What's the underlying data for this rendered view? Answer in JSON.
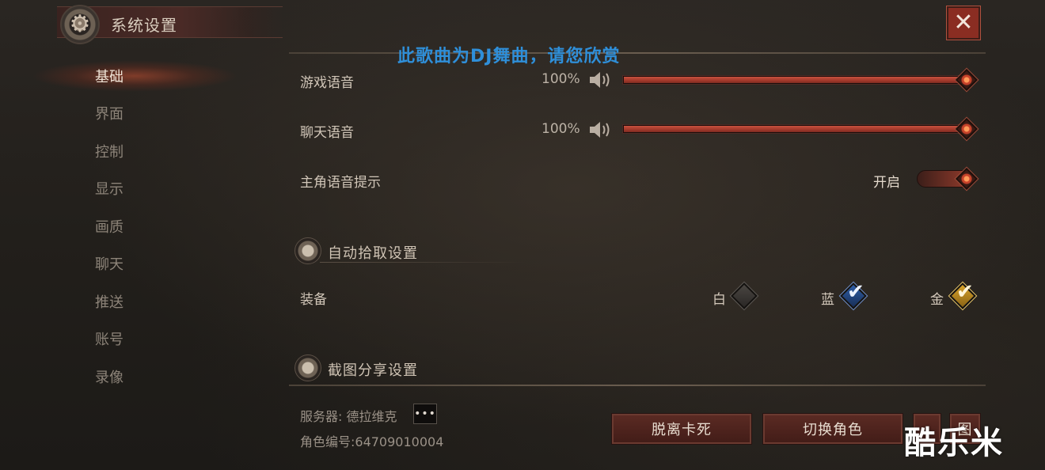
{
  "window": {
    "title": "系统设置",
    "close_glyph": "✕",
    "gear_glyph": "⚙"
  },
  "watermark_top": "此歌曲为DJ舞曲，请您欣赏",
  "watermark_bottom_right": "酷乐米",
  "sidebar": {
    "active_index": 0,
    "items": [
      {
        "label": "基础"
      },
      {
        "label": "界面"
      },
      {
        "label": "控制"
      },
      {
        "label": "显示"
      },
      {
        "label": "画质"
      },
      {
        "label": "聊天"
      },
      {
        "label": "推送"
      },
      {
        "label": "账号"
      },
      {
        "label": "录像"
      }
    ]
  },
  "audio": {
    "game_voice": {
      "label": "游戏语音",
      "percent_text": "100%",
      "value": 1.0
    },
    "chat_voice": {
      "label": "聊天语音",
      "percent_text": "100%",
      "value": 1.0
    },
    "hero_voice_hint": {
      "label": "主角语音提示",
      "state_text": "开启",
      "on": true
    }
  },
  "auto_pickup": {
    "title": "自动拾取设置",
    "equipment_label": "装备",
    "options": [
      {
        "label": "白",
        "checked": false,
        "color": "#4a4642"
      },
      {
        "label": "蓝",
        "checked": true,
        "color": "#2f5fa8"
      },
      {
        "label": "金",
        "checked": true,
        "color": "#d9a42b"
      }
    ],
    "check_glyph": "✔"
  },
  "screenshot_share": {
    "title": "截图分享设置"
  },
  "footer": {
    "server_text": "服务器: 德拉维克",
    "more_glyph": "•••",
    "role_id_text": "角色编号:64709010004",
    "unstuck_button": "脱离卡死",
    "switch_role_button": "切换角色",
    "extra_button_1": "",
    "extra_button_2": "图"
  },
  "colors": {
    "accent_red": "#a3392b",
    "watermark_blue": "#2f8fd9"
  }
}
